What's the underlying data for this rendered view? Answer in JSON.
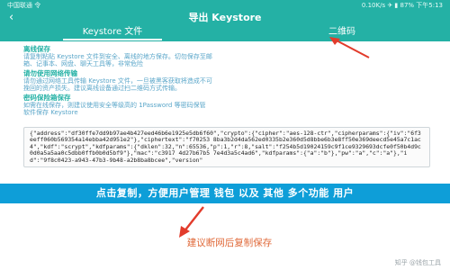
{
  "status_bar": {
    "left": "中国联通 令",
    "right": "0.10K/s ✈ ▮ 87% 下午5:13"
  },
  "app_bar": {
    "title": "导出 Keystore"
  },
  "tabs": [
    {
      "label": "Keystore 文件",
      "active": true
    },
    {
      "label": "二维码",
      "active": false
    }
  ],
  "sections": [
    {
      "title": "离线保存",
      "lines": [
        "请复制粘贴 Keystore 文件到安全、离线的地方保存。切勿保存至邮",
        "箱、记事本、网盘、聊天工具等，非常危险"
      ]
    },
    {
      "title": "请勿使用网络传输",
      "lines": [
        "请勿通过网络工具传输 Keystore 文件，一旦被黑客获取将造成不可",
        "挽回的资产损失。建议离线设备通过扫二维码方式传输。"
      ]
    },
    {
      "title": "密码保险箱保存",
      "lines": [
        "如需在线保存，则建议使用安全等级高的 1Password 等密码保管",
        "软件保存 Keystore"
      ]
    }
  ],
  "keystore_text": "{\"address\":\"df30ffe7dd9b97ae4b427eed46b6e1925e5db6f60\",\"crypto\":{\"cipher\":\"aes-128-ctr\",\"cipherparams\":{\"iv\":\"6f3eeff060b569354a14ebba42d951e2\"},\"ciphertext\":\"f70253\n8ba3b2d4da562ed0335b2e360d5d8bbe6b3e8ff50e369deecd5e45a7c1ac4\",\"kdf\":\"scrypt\",\"kdfparams\":{\"dklen\":32,\"n\":65536,\"p\":1,\"r\":8,\"salt\":\"f254b5d19024159c9f1ce9329693dcfe0f50b4d9c0d0a5a5aa0c5dbb0ffb0b0d5bf9\"},\"mac\":\"c3917 4d27b67b5\n7e4d3a5c4ad6\",\"kdfparams\":{\"a\":\"b\"},\"pw\":\"a\",\"c\":\"a\"},\"id\":\"9f8c0423-a943-47b3-9b48-a2b8ba8bcee\",\"version\"",
  "annotation": "点击复制，方便用户管理 钱包 以及 其他 多个功能 用户",
  "copy_button": "建议断网后复制保存",
  "footer_mark": "知乎 @钱包工具"
}
